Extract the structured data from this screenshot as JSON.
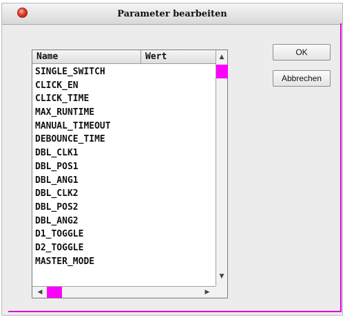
{
  "window": {
    "title": "Parameter bearbeiten"
  },
  "table": {
    "columns": [
      "Name",
      "Wert"
    ],
    "rows": [
      {
        "name": "SINGLE_SWITCH",
        "value": ""
      },
      {
        "name": "CLICK_EN",
        "value": ""
      },
      {
        "name": "CLICK_TIME",
        "value": ""
      },
      {
        "name": "MAX_RUNTIME",
        "value": ""
      },
      {
        "name": "MANUAL_TIMEOUT",
        "value": ""
      },
      {
        "name": "DEBOUNCE_TIME",
        "value": ""
      },
      {
        "name": "DBL_CLK1",
        "value": ""
      },
      {
        "name": "DBL_POS1",
        "value": ""
      },
      {
        "name": "DBL_ANG1",
        "value": ""
      },
      {
        "name": "DBL_CLK2",
        "value": ""
      },
      {
        "name": "DBL_POS2",
        "value": ""
      },
      {
        "name": "DBL_ANG2",
        "value": ""
      },
      {
        "name": "D1_TOGGLE",
        "value": ""
      },
      {
        "name": "D2_TOGGLE",
        "value": ""
      },
      {
        "name": "MASTER_MODE",
        "value": ""
      }
    ]
  },
  "buttons": {
    "ok_label": "OK",
    "cancel_label": "Abbrechen"
  },
  "icons": {
    "close": "close-icon",
    "scroll_up": "arrow-up-icon",
    "scroll_down": "arrow-down-icon",
    "scroll_left": "arrow-left-icon",
    "scroll_right": "arrow-right-icon"
  },
  "colors": {
    "scroll_thumb": "#ff00ff",
    "window_accent": "#e000e0",
    "close_button": "#e23a26"
  }
}
